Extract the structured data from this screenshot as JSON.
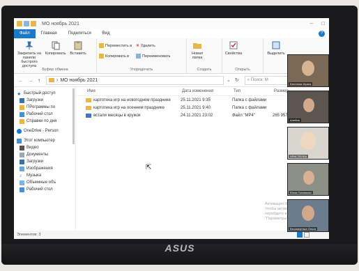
{
  "window": {
    "title": "МО ноябрь 2021",
    "tabs": [
      "Файл",
      "Главная",
      "Поделиться",
      "Вид"
    ]
  },
  "ribbon": {
    "clipboard": {
      "pin_label": "Закрепить на панели быстрого доступа",
      "copy_label": "Копировать",
      "paste_label": "Вставить",
      "group_label": "Буфер обмена"
    },
    "organize": {
      "move_label": "Переместить в",
      "copy_to_label": "Копировать в",
      "delete_label": "Удалить",
      "rename_label": "Переименовать",
      "group_label": "Упорядочить"
    },
    "create": {
      "new_folder_label": "Новая папка",
      "group_label": "Создать"
    },
    "open": {
      "properties_label": "Свойства",
      "group_label": "Открыть"
    },
    "select": {
      "select_label": "Выделить"
    }
  },
  "address": {
    "path": "МО ноябрь 2021",
    "search_placeholder": "Поиск: М"
  },
  "nav_pane": {
    "items": [
      "Быстрый доступ",
      "Загрузки",
      "ПРограммы по",
      "Рабочий стол",
      "Справки по дня",
      "OneDrive - Person",
      "Этот компьютер",
      "Видео",
      "Документы",
      "Загрузки",
      "Изображения",
      "Музыка",
      "Объемные объ",
      "Рабочий стол"
    ]
  },
  "file_list": {
    "columns": [
      "Имя",
      "Дата изменения",
      "Тип",
      "Размер"
    ],
    "rows": [
      {
        "name": "картотека игр на новогоднем празднике",
        "date": "25.11.2021 9:35",
        "type": "Папка с файлами",
        "size": ""
      },
      {
        "name": "картотека игр на осеннем празднике",
        "date": "25.11.2021 9:40",
        "type": "Папка с файлами",
        "size": ""
      },
      {
        "name": "встали месяцы в кружок",
        "date": "24.11.2021 23:02",
        "type": "Файл \"MP4\"",
        "size": "265 957 КБ"
      }
    ]
  },
  "status": {
    "count": "Элементов: 3"
  },
  "watermark": {
    "line1": "Активация Windows",
    "line2": "Чтобы активировать Windows, перейдите в раздел \"Параметры\"."
  },
  "video_tiles": [
    {
      "name": "Батенева Ирина"
    },
    {
      "name": "Алейна"
    },
    {
      "name": "ХРИСТЕЛЛА"
    },
    {
      "name": "Юлия Головская"
    },
    {
      "name": "Бессмертных Ольга"
    }
  ],
  "brand": "ASUS",
  "colors": {
    "accent": "#1979ca",
    "folder": "#e9b64a"
  }
}
